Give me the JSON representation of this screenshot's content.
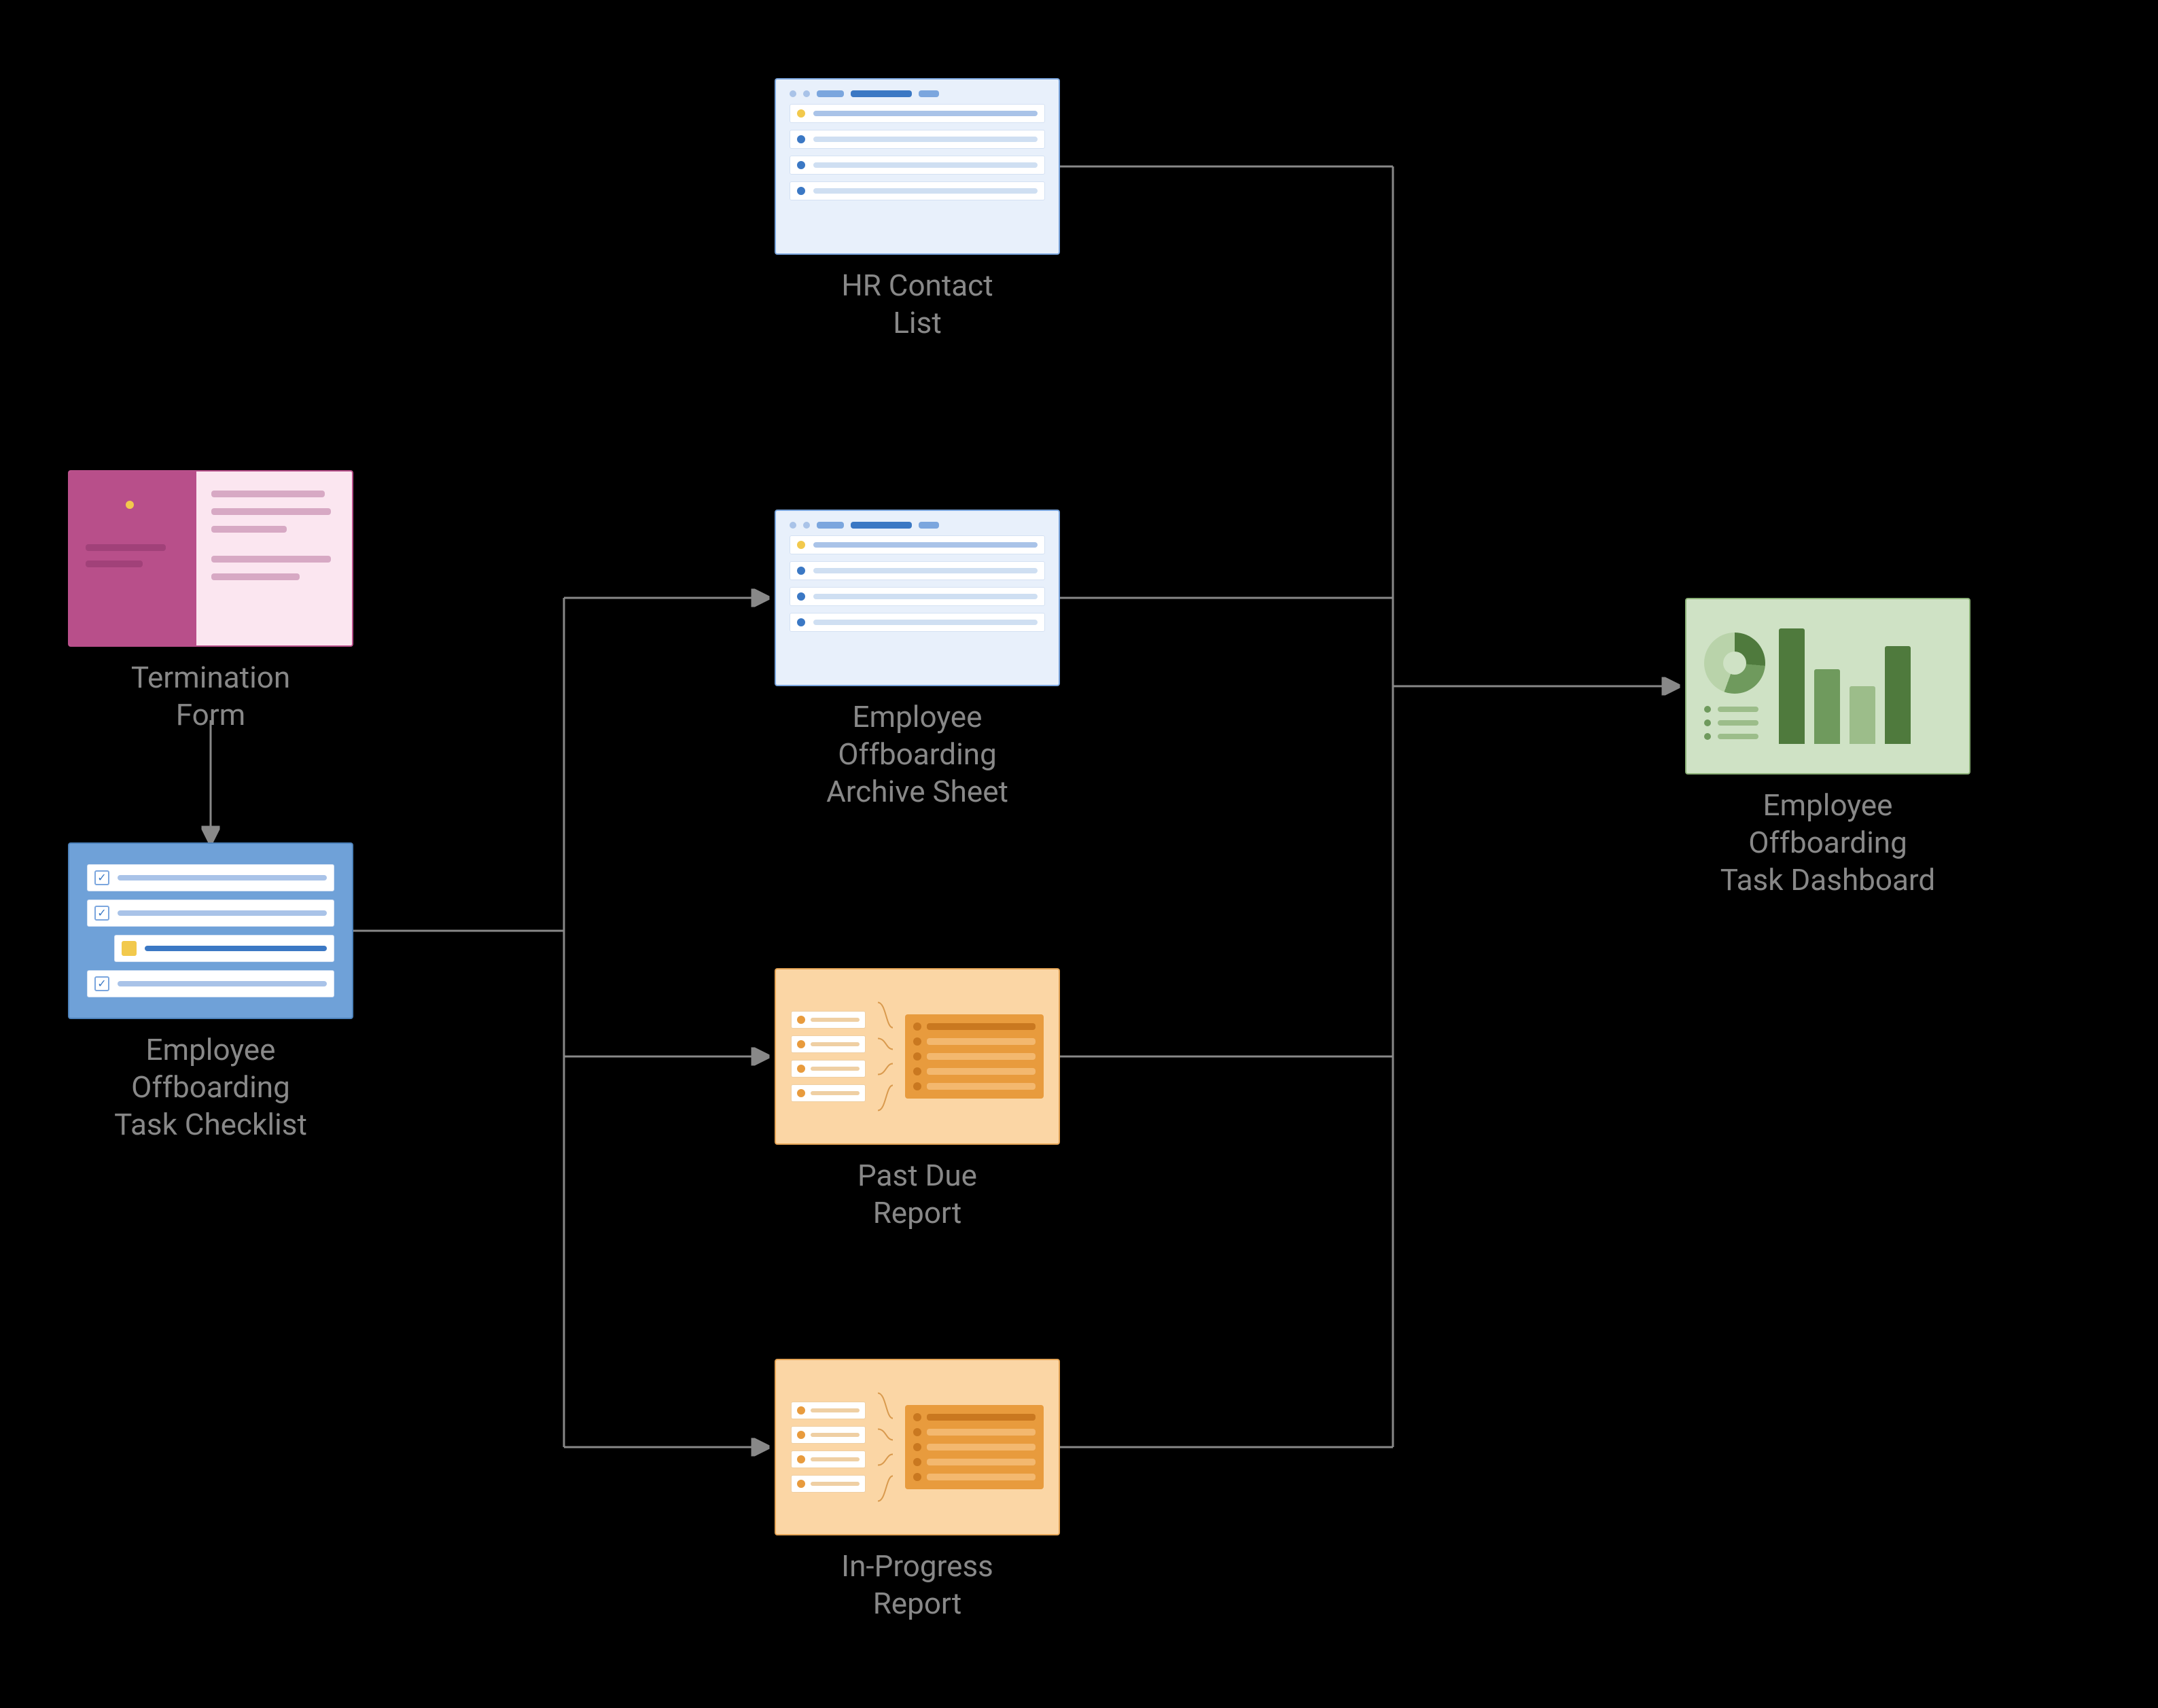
{
  "nodes": {
    "termination_form": {
      "label": "Termination\nForm"
    },
    "hr_contact_list": {
      "label": "HR Contact\nList"
    },
    "checklist": {
      "label": "Employee\nOffboarding\nTask Checklist"
    },
    "archive_sheet": {
      "label": "Employee\nOffboarding\nArchive Sheet"
    },
    "past_due_report": {
      "label": "Past Due\nReport"
    },
    "in_progress_report": {
      "label": "In-Progress\nReport"
    },
    "dashboard": {
      "label": "Employee\nOffboarding\nTask Dashboard"
    }
  },
  "edges": [
    {
      "from": "termination_form",
      "to": "checklist"
    },
    {
      "from": "checklist",
      "to": "archive_sheet"
    },
    {
      "from": "checklist",
      "to": "past_due_report"
    },
    {
      "from": "checklist",
      "to": "in_progress_report"
    },
    {
      "from": "hr_contact_list",
      "to": "dashboard"
    },
    {
      "from": "archive_sheet",
      "to": "dashboard"
    },
    {
      "from": "past_due_report",
      "to": "dashboard"
    },
    {
      "from": "in_progress_report",
      "to": "dashboard"
    }
  ],
  "colors": {
    "form": "#b84f8a",
    "sheet": "#7ba6de",
    "checklist": "#6fa1d8",
    "report": "#e89b3d",
    "dashboard": "#6f9a5d",
    "connector": "#888888",
    "label": "#888888"
  }
}
